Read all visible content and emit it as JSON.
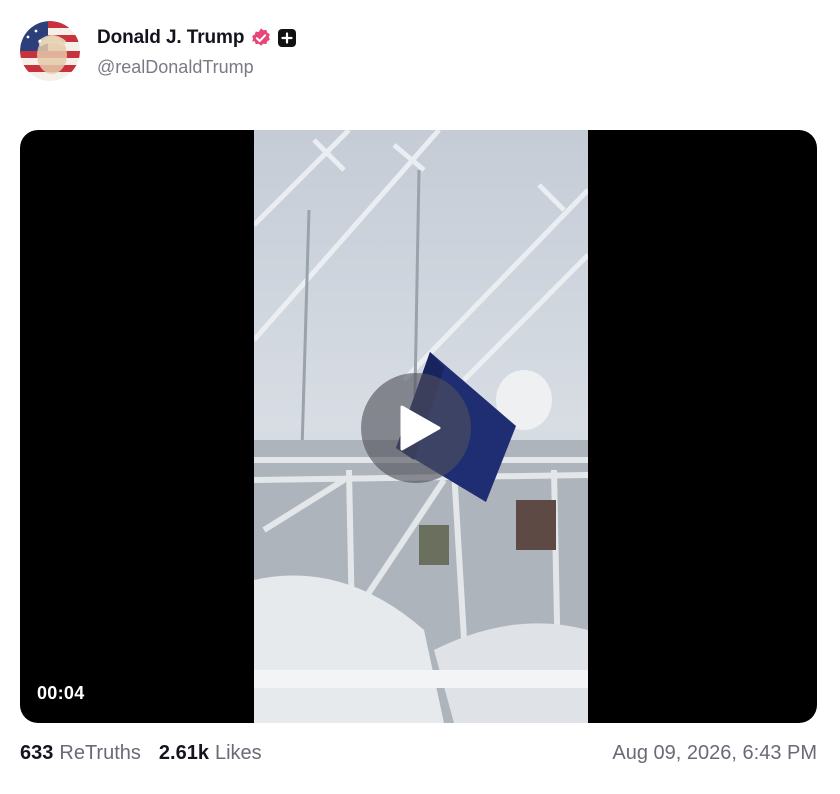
{
  "post": {
    "author": {
      "display_name": "Donald J. Trump",
      "handle": "@realDonaldTrump",
      "verified_icon": "verified-badge-icon",
      "verified_color": "#e6467a",
      "badge_icon": "plus-icon"
    },
    "media": {
      "type": "video",
      "elapsed": "00:04",
      "play_icon": "play-icon"
    },
    "stats": {
      "retruths_count": "633",
      "retruths_label": "ReTruths",
      "likes_count": "2.61k",
      "likes_label": "Likes"
    },
    "date": "Aug 09, 2026, 6:43 PM"
  }
}
